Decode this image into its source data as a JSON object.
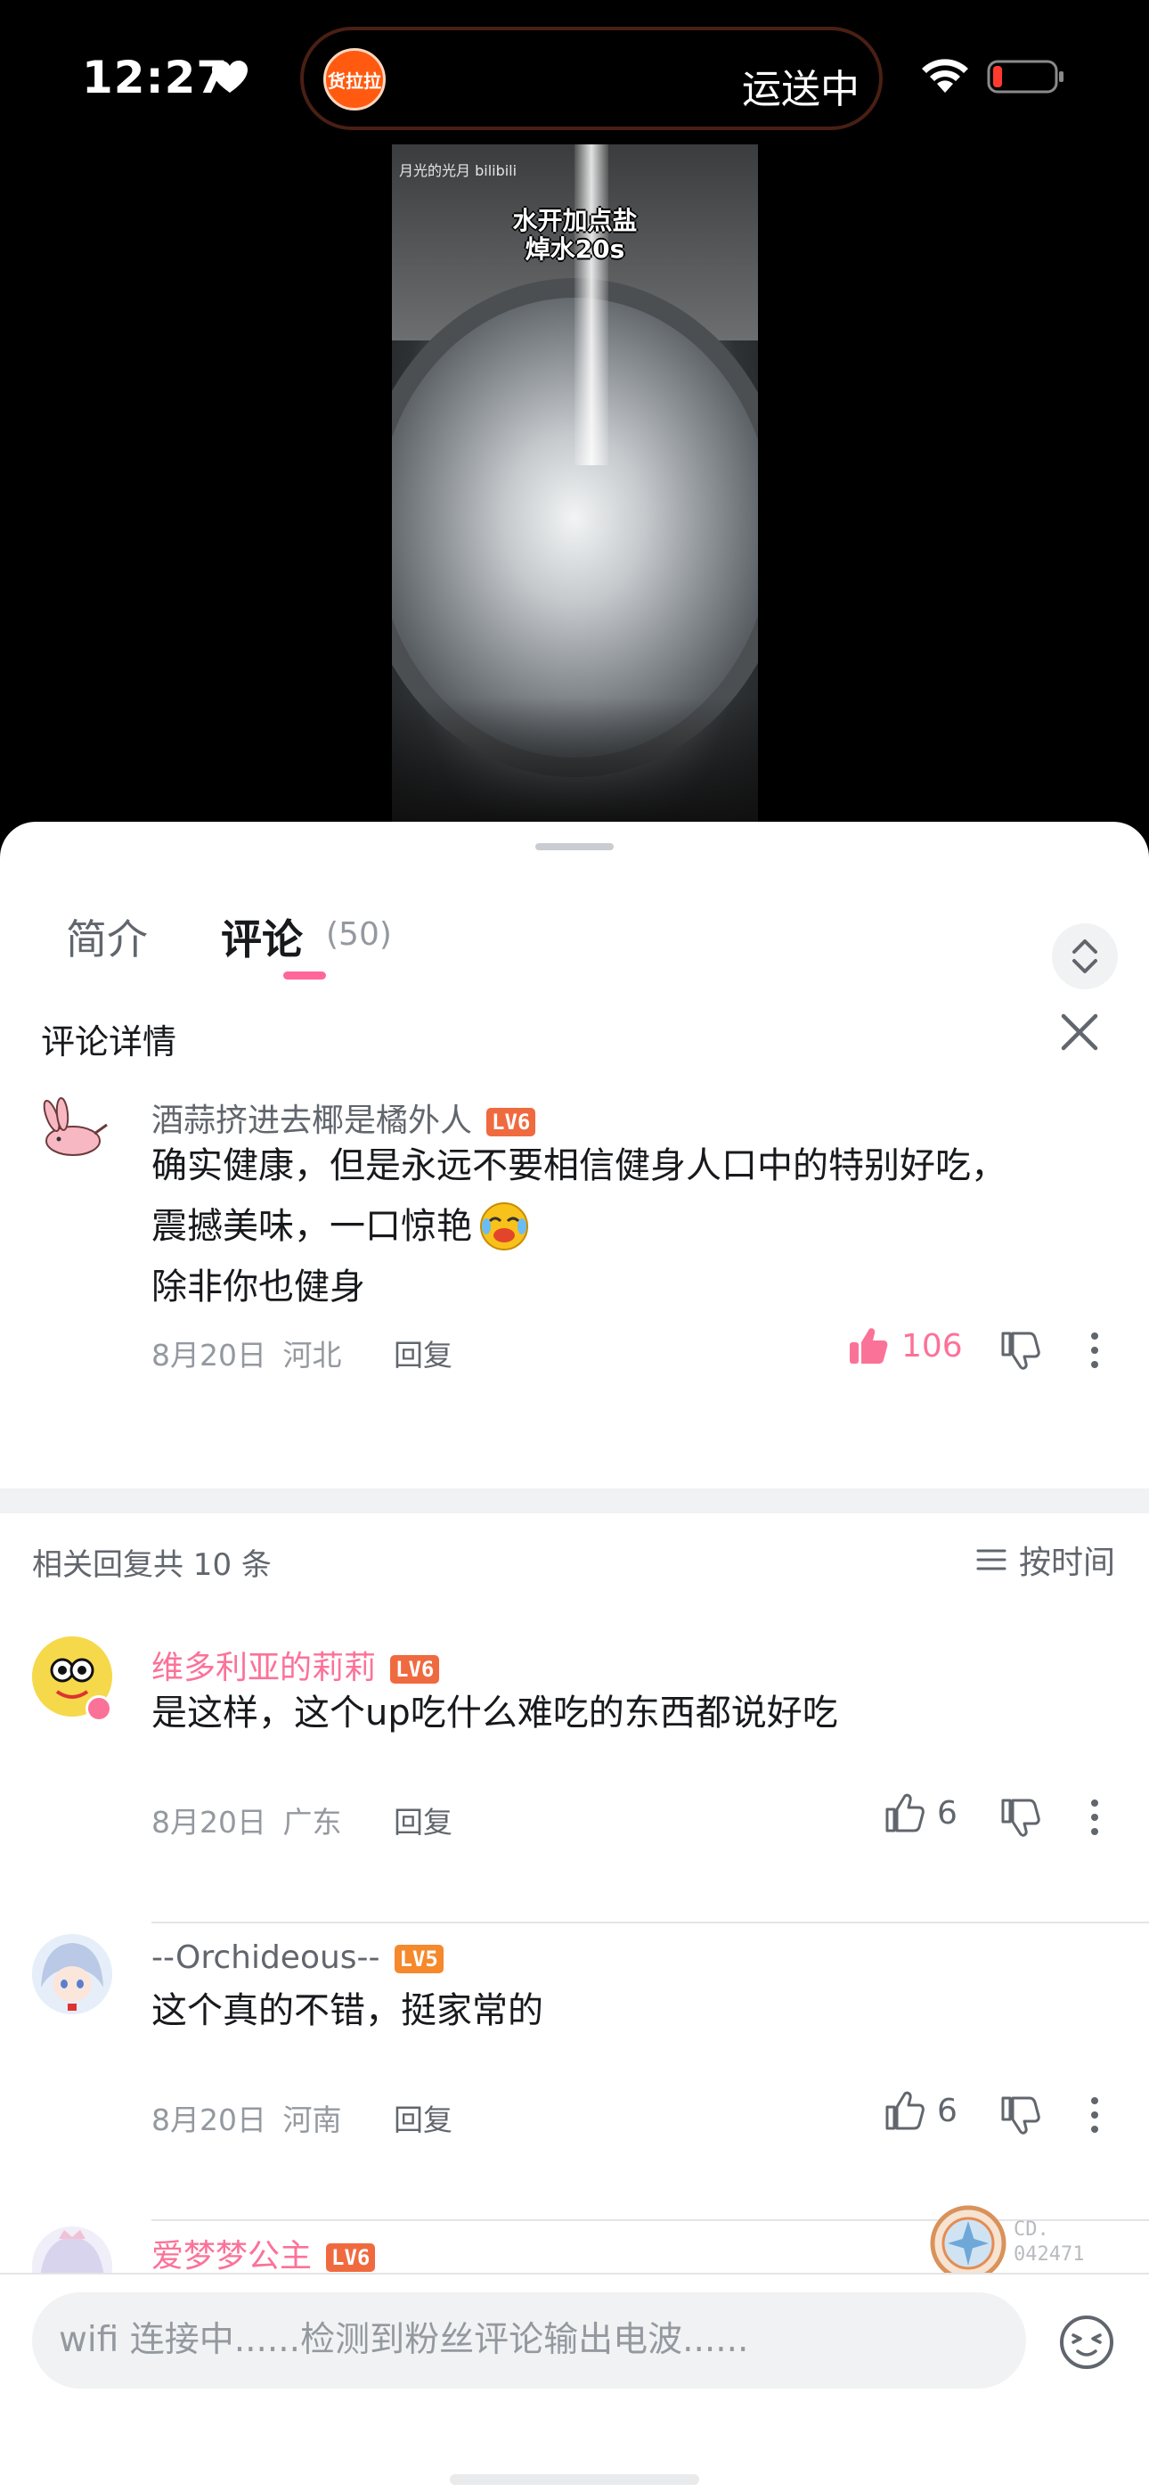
{
  "status_bar": {
    "time": "12:27",
    "island_app_label": "货拉拉",
    "island_text": "运送中"
  },
  "video": {
    "watermark": "月光的光月 bilibili",
    "caption_line1": "水开加点盐",
    "caption_line2": "焯水20s"
  },
  "tabs": {
    "intro": "简介",
    "comments": "评论",
    "comments_count": "(50)"
  },
  "detail": {
    "title": "评论详情"
  },
  "main_comment": {
    "username": "酒蒜挤进去椰是橘外人",
    "level": "LV6",
    "text_line1": "确实健康，但是永远不要相信健身人口中的特别好吃，",
    "text_line2": "震撼美味，一口惊艳",
    "text_line3": "除非你也健身",
    "date": "8月20日",
    "location": "河北",
    "reply_label": "回复",
    "likes": "106"
  },
  "replies_header": {
    "count_text": "相关回复共 10 条",
    "sort_label": "按时间"
  },
  "replies": [
    {
      "username": "维多利亚的莉莉",
      "level": "LV6",
      "text": "是这样，这个up吃什么难吃的东西都说好吃",
      "date": "8月20日",
      "location": "广东",
      "reply_label": "回复",
      "likes": "6"
    },
    {
      "username": "--Orchideous--",
      "level": "LV5",
      "text": "这个真的不错，挺家常的",
      "date": "8月20日",
      "location": "河南",
      "reply_label": "回复",
      "likes": "6"
    },
    {
      "username": "爱梦梦公主",
      "level": "LV6"
    }
  ],
  "badge": {
    "line1": "CD.",
    "line2": "042471"
  },
  "input": {
    "placeholder": "wifi 连接中......检测到粉丝评论输出电波......"
  },
  "colors": {
    "accent_pink": "#fb7299",
    "level_orange": "#f06a3f"
  }
}
